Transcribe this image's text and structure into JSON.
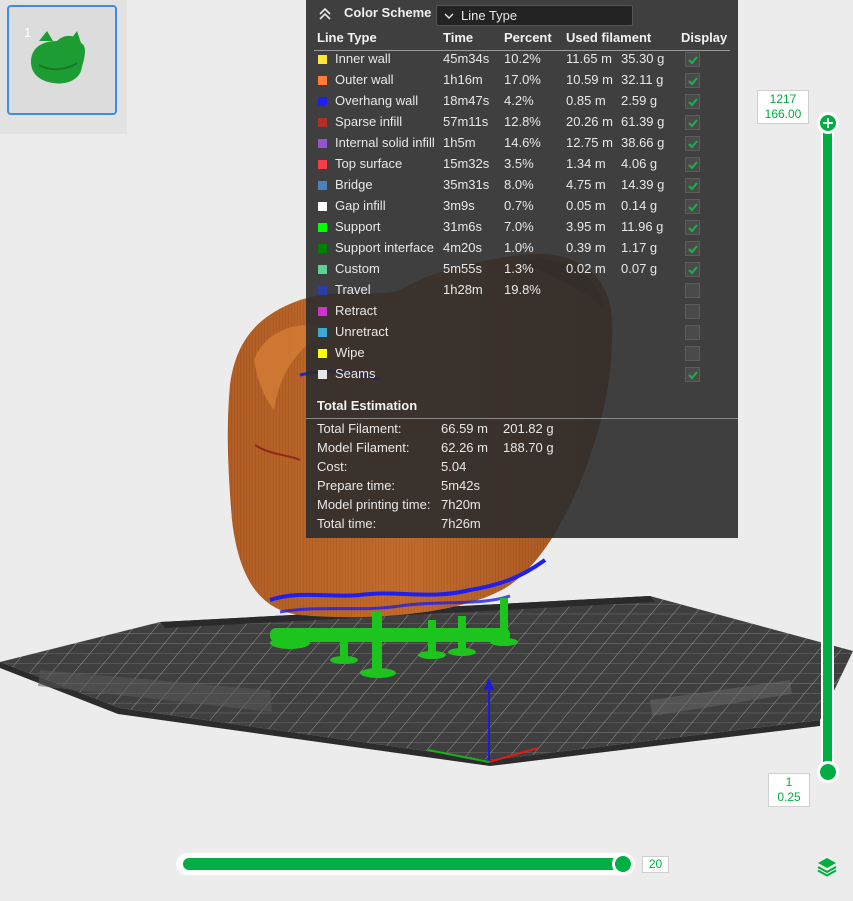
{
  "thumbnail": {
    "index": "1"
  },
  "legend": {
    "title": "Color Scheme",
    "scheme_value": "Line Type",
    "columns": {
      "line_type": "Line Type",
      "time": "Time",
      "percent": "Percent",
      "used_filament": "Used filament",
      "display": "Display"
    },
    "rows": [
      {
        "name": "Inner wall",
        "time": "45m34s",
        "percent": "10.2%",
        "length": "11.65 m",
        "weight": "35.30 g",
        "color": "#ffe43d",
        "display": "checked"
      },
      {
        "name": "Outer wall",
        "time": "1h16m",
        "percent": "17.0%",
        "length": "10.59 m",
        "weight": "32.11 g",
        "color": "#ff7d38",
        "display": "checked"
      },
      {
        "name": "Overhang wall",
        "time": "18m47s",
        "percent": "4.2%",
        "length": "0.85 m",
        "weight": "2.59 g",
        "color": "#1f1ff0",
        "display": "checked"
      },
      {
        "name": "Sparse infill",
        "time": "57m11s",
        "percent": "12.8%",
        "length": "20.26 m",
        "weight": "61.39 g",
        "color": "#b03029",
        "display": "checked"
      },
      {
        "name": "Internal solid infill",
        "time": "1h5m",
        "percent": "14.6%",
        "length": "12.75 m",
        "weight": "38.66 g",
        "color": "#9654cc",
        "display": "checked"
      },
      {
        "name": "Top surface",
        "time": "15m32s",
        "percent": "3.5%",
        "length": "1.34 m",
        "weight": "4.06 g",
        "color": "#f0404a",
        "display": "checked"
      },
      {
        "name": "Bridge",
        "time": "35m31s",
        "percent": "8.0%",
        "length": "4.75 m",
        "weight": "14.39 g",
        "color": "#4d80ba",
        "display": "checked"
      },
      {
        "name": "Gap infill",
        "time": "3m9s",
        "percent": "0.7%",
        "length": "0.05 m",
        "weight": "0.14 g",
        "color": "#ffffff",
        "display": "checked"
      },
      {
        "name": "Support",
        "time": "31m6s",
        "percent": "7.0%",
        "length": "3.95 m",
        "weight": "11.96 g",
        "color": "#00ff00",
        "display": "checked"
      },
      {
        "name": "Support interface",
        "time": "4m20s",
        "percent": "1.0%",
        "length": "0.39 m",
        "weight": "1.17 g",
        "color": "#008000",
        "display": "checked"
      },
      {
        "name": "Custom",
        "time": "5m55s",
        "percent": "1.3%",
        "length": "0.02 m",
        "weight": "0.07 g",
        "color": "#5ed194",
        "display": "checked"
      },
      {
        "name": "Travel",
        "time": "1h28m",
        "percent": "19.8%",
        "length": "",
        "weight": "",
        "color": "#2c3ea6",
        "display": "unchecked"
      },
      {
        "name": "Retract",
        "time": "",
        "percent": "",
        "length": "",
        "weight": "",
        "color": "#cc33cc",
        "display": "unchecked"
      },
      {
        "name": "Unretract",
        "time": "",
        "percent": "",
        "length": "",
        "weight": "",
        "color": "#3fa9d6",
        "display": "unchecked"
      },
      {
        "name": "Wipe",
        "time": "",
        "percent": "",
        "length": "",
        "weight": "",
        "color": "#ffff00",
        "display": "unchecked"
      },
      {
        "name": "Seams",
        "time": "",
        "percent": "",
        "length": "",
        "weight": "",
        "color": "#e6e6e6",
        "display": "checked"
      }
    ],
    "total_title": "Total Estimation",
    "totals": [
      {
        "label": "Total Filament:",
        "value": "66.59 m",
        "value2": "201.82 g"
      },
      {
        "label": "Model Filament:",
        "value": "62.26 m",
        "value2": "188.70 g"
      },
      {
        "label": "Cost:",
        "value": "5.04",
        "value2": ""
      },
      {
        "label": "Prepare time:",
        "value": "5m42s",
        "value2": ""
      },
      {
        "label": "Model printing time:",
        "value": "7h20m",
        "value2": ""
      },
      {
        "label": "Total time:",
        "value": "7h26m",
        "value2": ""
      }
    ]
  },
  "layer_slider": {
    "top_layer": "1217",
    "top_height": "166.00",
    "bottom_layer": "1",
    "bottom_height": "0.25"
  },
  "move_slider": {
    "value": "20"
  },
  "colors": {
    "accent": "#00ae42",
    "selection": "#3a8ee6",
    "model": "#b35d25",
    "support": "#1ec41e",
    "overhang": "#1f1ff0"
  },
  "icons": {
    "collapse": "double-chevron-up-icon",
    "dropdown": "chevron-down-icon",
    "checkbox": "checkmark-icon",
    "layers": "layers-icon"
  }
}
